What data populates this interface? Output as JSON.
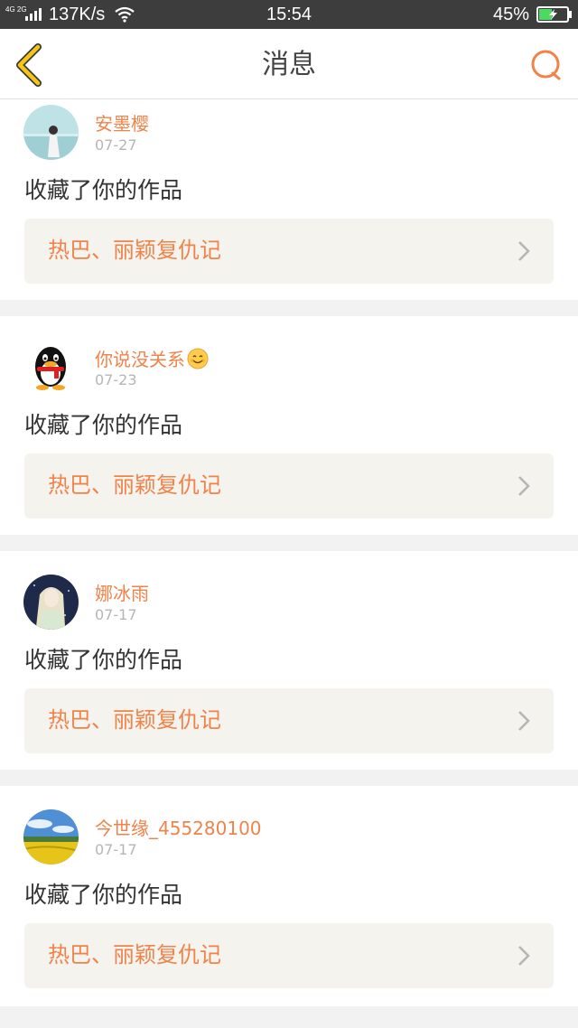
{
  "status_bar": {
    "network_type": "4G 2G",
    "speed": "137K/s",
    "time": "15:54",
    "battery": "45%"
  },
  "header": {
    "title": "消息",
    "back_icon": "chevron-left-icon",
    "search_icon": "search-icon"
  },
  "colors": {
    "accent": "#f0834a",
    "back_arrow": "#f5c518"
  },
  "messages": [
    {
      "username": "安墨樱",
      "date": "07-27",
      "action": "收藏了你的作品",
      "work_title": "热巴、丽颖复仇记"
    },
    {
      "username": "你说没关系",
      "date": "07-23",
      "action": "收藏了你的作品",
      "work_title": "热巴、丽颖复仇记",
      "username_emoji": "smiling-face-icon"
    },
    {
      "username": "娜冰雨",
      "date": "07-17",
      "action": "收藏了你的作品",
      "work_title": "热巴、丽颖复仇记"
    },
    {
      "username": "今世缘_455280100",
      "date": "07-17",
      "action": "收藏了你的作品",
      "work_title": "热巴、丽颖复仇记"
    }
  ]
}
